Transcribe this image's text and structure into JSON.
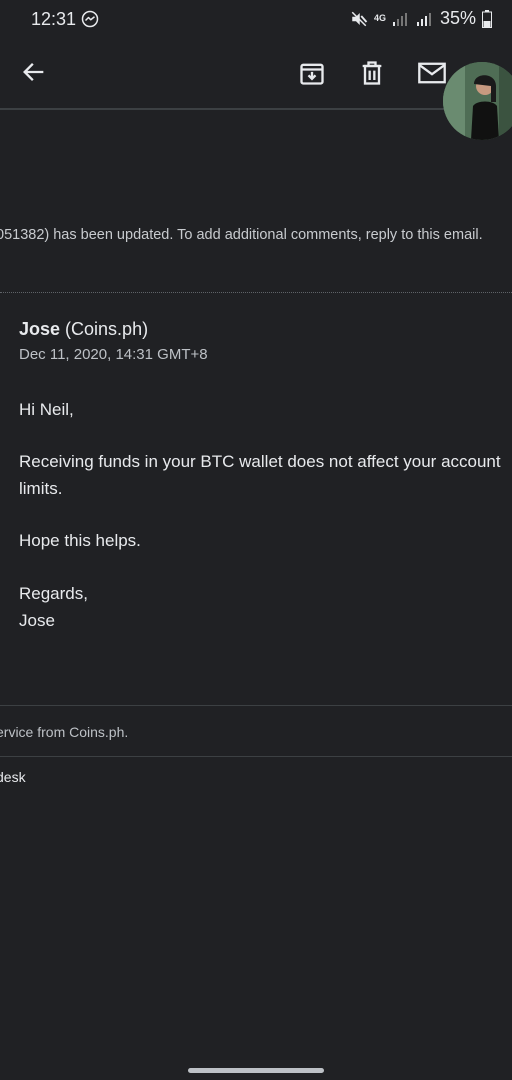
{
  "status_bar": {
    "time": "12:31",
    "battery": "35%",
    "network_label": "4G"
  },
  "toolbar": {
    "back_icon": "arrow-left-icon",
    "archive_icon": "archive-icon",
    "delete_icon": "trash-icon",
    "mail_icon": "mail-icon"
  },
  "email": {
    "snippet": "051382) has been updated. To add additional comments, reply to this email.",
    "sender_name": "Jose",
    "sender_org": "(Coins.ph)",
    "date": "Dec 11, 2020, 14:31 GMT+8",
    "greeting": "Hi Neil,",
    "paragraph": "Receiving funds in your BTC wallet does not affect your account limits.",
    "closing_line": "Hope this helps.",
    "regards": "Regards,",
    "signature": "Jose"
  },
  "footer": {
    "service_text": "ervice from Coins.ph.",
    "desk_text": "desk"
  },
  "colors": {
    "background": "#202124",
    "text": "#e8eaed",
    "muted": "#bdc1c6"
  }
}
